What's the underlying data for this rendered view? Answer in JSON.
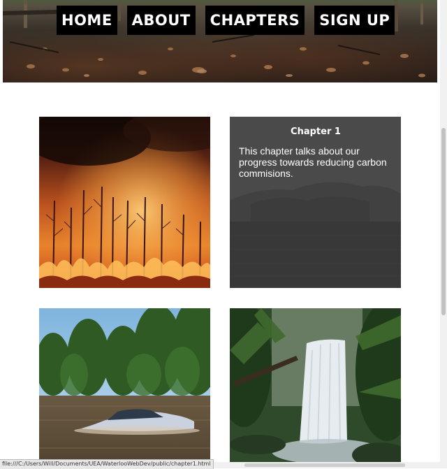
{
  "nav": {
    "items": [
      {
        "label": "HOME"
      },
      {
        "label": "ABOUT"
      },
      {
        "label": "CHAPTERS"
      },
      {
        "label": "SIGN UP"
      }
    ]
  },
  "chapter_card": {
    "title": "Chapter 1",
    "text": "This chapter talks about our progress towards reducing carbon commisions."
  },
  "images": {
    "hero": "burnt-forest-floor-image",
    "tile_1": "wildfire-forest-image",
    "tile_3": "flooded-car-image",
    "tile_4": "rainforest-waterfall-image"
  },
  "status_bar": {
    "url": "file:///C:/Users/Will/Documents/UEA/WaterlooWebDev/public/chapter1.html"
  },
  "colors": {
    "nav_bg": "#000000",
    "nav_text": "#ffffff",
    "card_bg": "#474747",
    "page_bg": "#ffffff"
  }
}
